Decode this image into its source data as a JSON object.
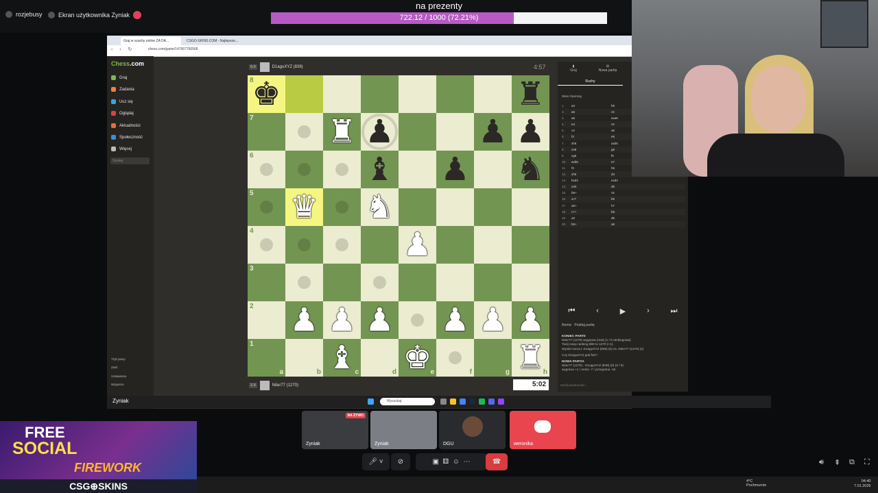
{
  "topbar": {
    "user": "rozjebusy",
    "screen_label": "Ekran użytkownika Zyniak"
  },
  "goal": {
    "title": "na prezenty",
    "progress_text": "722.12 / 1000 (72.21%)",
    "progress_fraction": 0.7221
  },
  "browser": {
    "tabs": [
      "Graj w szachy online ZA DA...",
      "CSGO-SKINS.COM - Najlepsze..."
    ],
    "url": "chess.com/game/147667760568"
  },
  "sidebar": {
    "logo_part1": "Chess",
    "logo_part2": ".com",
    "items": [
      {
        "label": "Graj",
        "color": "#81b64c"
      },
      {
        "label": "Zadania",
        "color": "#f1803a"
      },
      {
        "label": "Ucz się",
        "color": "#3aa3e0"
      },
      {
        "label": "Oglądaj",
        "color": "#d94242"
      },
      {
        "label": "Aktualności",
        "color": "#e86c3c"
      },
      {
        "label": "Społeczność",
        "color": "#3b8fd6"
      },
      {
        "label": "Więcej",
        "color": "#bbbbbb"
      }
    ],
    "search_placeholder": "Szukaj",
    "bottom_items": [
      "Tryb jasny",
      "Zwiń",
      "Ustawienia",
      "Wsparcie"
    ],
    "taskbar_label": "Zyniak"
  },
  "players": {
    "top": {
      "eval": "0.0",
      "name": "D1aguXYZ (839)",
      "clock": "4:57"
    },
    "bottom": {
      "eval": "2.0",
      "name": "Niter77 (1270)",
      "clock": "5:02"
    }
  },
  "right_panel": {
    "tab_play": "Graj",
    "tab_new": "Nowa partia",
    "moves_header": "Ruchy",
    "opening": "Ware Opening",
    "moves": [
      [
        "1.",
        "a4",
        "h5"
      ],
      [
        "2.",
        "a5",
        "c6"
      ],
      [
        "3.",
        "a6",
        "axa6"
      ],
      [
        "4.",
        "e4",
        "c5"
      ],
      [
        "5.",
        "c3",
        "a6"
      ],
      [
        "6.",
        "f3",
        "e5"
      ],
      [
        "7.",
        "xh5",
        "axb5"
      ],
      [
        "8.",
        "xe8",
        "g5"
      ],
      [
        "9.",
        "xg5",
        "f6"
      ],
      [
        "10.",
        "axb5",
        "e7"
      ],
      [
        "11.",
        "f3",
        "h6"
      ],
      [
        "12.",
        "xh5",
        "d4"
      ],
      [
        "13.",
        "bxd4",
        "exd4"
      ],
      [
        "14.",
        "xd4",
        "d6"
      ],
      [
        "15.",
        "b5+",
        "c5"
      ],
      [
        "16.",
        "xc7",
        "b6"
      ],
      [
        "17.",
        "a5+",
        "h7"
      ],
      [
        "18.",
        "c7+",
        "b8"
      ],
      [
        "19.",
        "a2",
        "d6"
      ],
      [
        "20.",
        "b5+",
        "a8"
      ]
    ],
    "nav": [
      "⏮",
      "‹",
      "▶",
      "›",
      "⏭"
    ],
    "draw_label": "Remis",
    "resign_label": "Poddaj partię",
    "chat": [
      "KONIEC PARTII",
      "Niter77 (1270) wygrywa (mat) (1 / 5 rankingowa)",
      "Twój nowy ranking 880 to 1270 (+1).",
      "Wyniki meczu: D1aguXYZ (839) (0) vs. Niter77 (1270) (2)",
      "Czy D1aguXYZ grał fair?",
      "NOWA PARTIA",
      "Niter77 (1270) - D1aguXYZ (839) (0) (0 / 5)",
      "wygrana +1 / remis -7 / przegrana -15"
    ],
    "message_placeholder": "Wyślij wiadomość..."
  },
  "board": {
    "rows": [
      [
        "bk",
        "",
        "",
        "",
        "",
        "",
        "",
        "br"
      ],
      [
        "",
        "",
        "wr",
        "bp",
        "",
        "",
        "bp",
        "bp"
      ],
      [
        "",
        "",
        "",
        "bb",
        "",
        "bp",
        "",
        "bn"
      ],
      [
        "",
        "wq",
        "",
        "wn",
        "",
        "",
        "",
        ""
      ],
      [
        "",
        "",
        "",
        "",
        "wp",
        "",
        "",
        ""
      ],
      [
        "",
        "",
        "",
        "",
        "",
        "",
        "",
        ""
      ],
      [
        "",
        "wp",
        "wp",
        "wp",
        "",
        "wp",
        "wp",
        "wp"
      ],
      [
        "",
        "",
        "wb",
        "",
        "wk",
        "",
        "",
        "wr"
      ]
    ],
    "highlights": [
      "a8",
      "b8",
      "b5"
    ],
    "dots": [
      "a6",
      "c6",
      "a5",
      "c5",
      "a4",
      "c4",
      "b3",
      "d3",
      "e2",
      "f1",
      "b7",
      "b6",
      "b4"
    ],
    "rings": [
      "d7"
    ],
    "ranks": [
      "8",
      "7",
      "6",
      "5",
      "4",
      "3",
      "2",
      "1"
    ],
    "files": [
      "a",
      "b",
      "c",
      "d",
      "e",
      "f",
      "g",
      "h"
    ]
  },
  "taskbar": {
    "search_placeholder": "Wyszukaj"
  },
  "call_tiles": [
    {
      "name": "Zyniak",
      "badge": "NA ŻYWO",
      "color": "#3a3c40"
    },
    {
      "name": "Zyniak",
      "color": "#7b7f85"
    },
    {
      "name": "DGU",
      "color": "#2a2b2e"
    },
    {
      "name": "weronika",
      "color": "#e8454e"
    }
  ],
  "ad": {
    "line1": "FREE",
    "line2": "SOCIAL",
    "line3": "FIREWORK",
    "brand": "CSG⊕SKINS"
  },
  "system": {
    "weather_temp": "4°C",
    "weather_desc": "Pochmurnie",
    "time": "04:40",
    "date": "7.01.2026"
  }
}
